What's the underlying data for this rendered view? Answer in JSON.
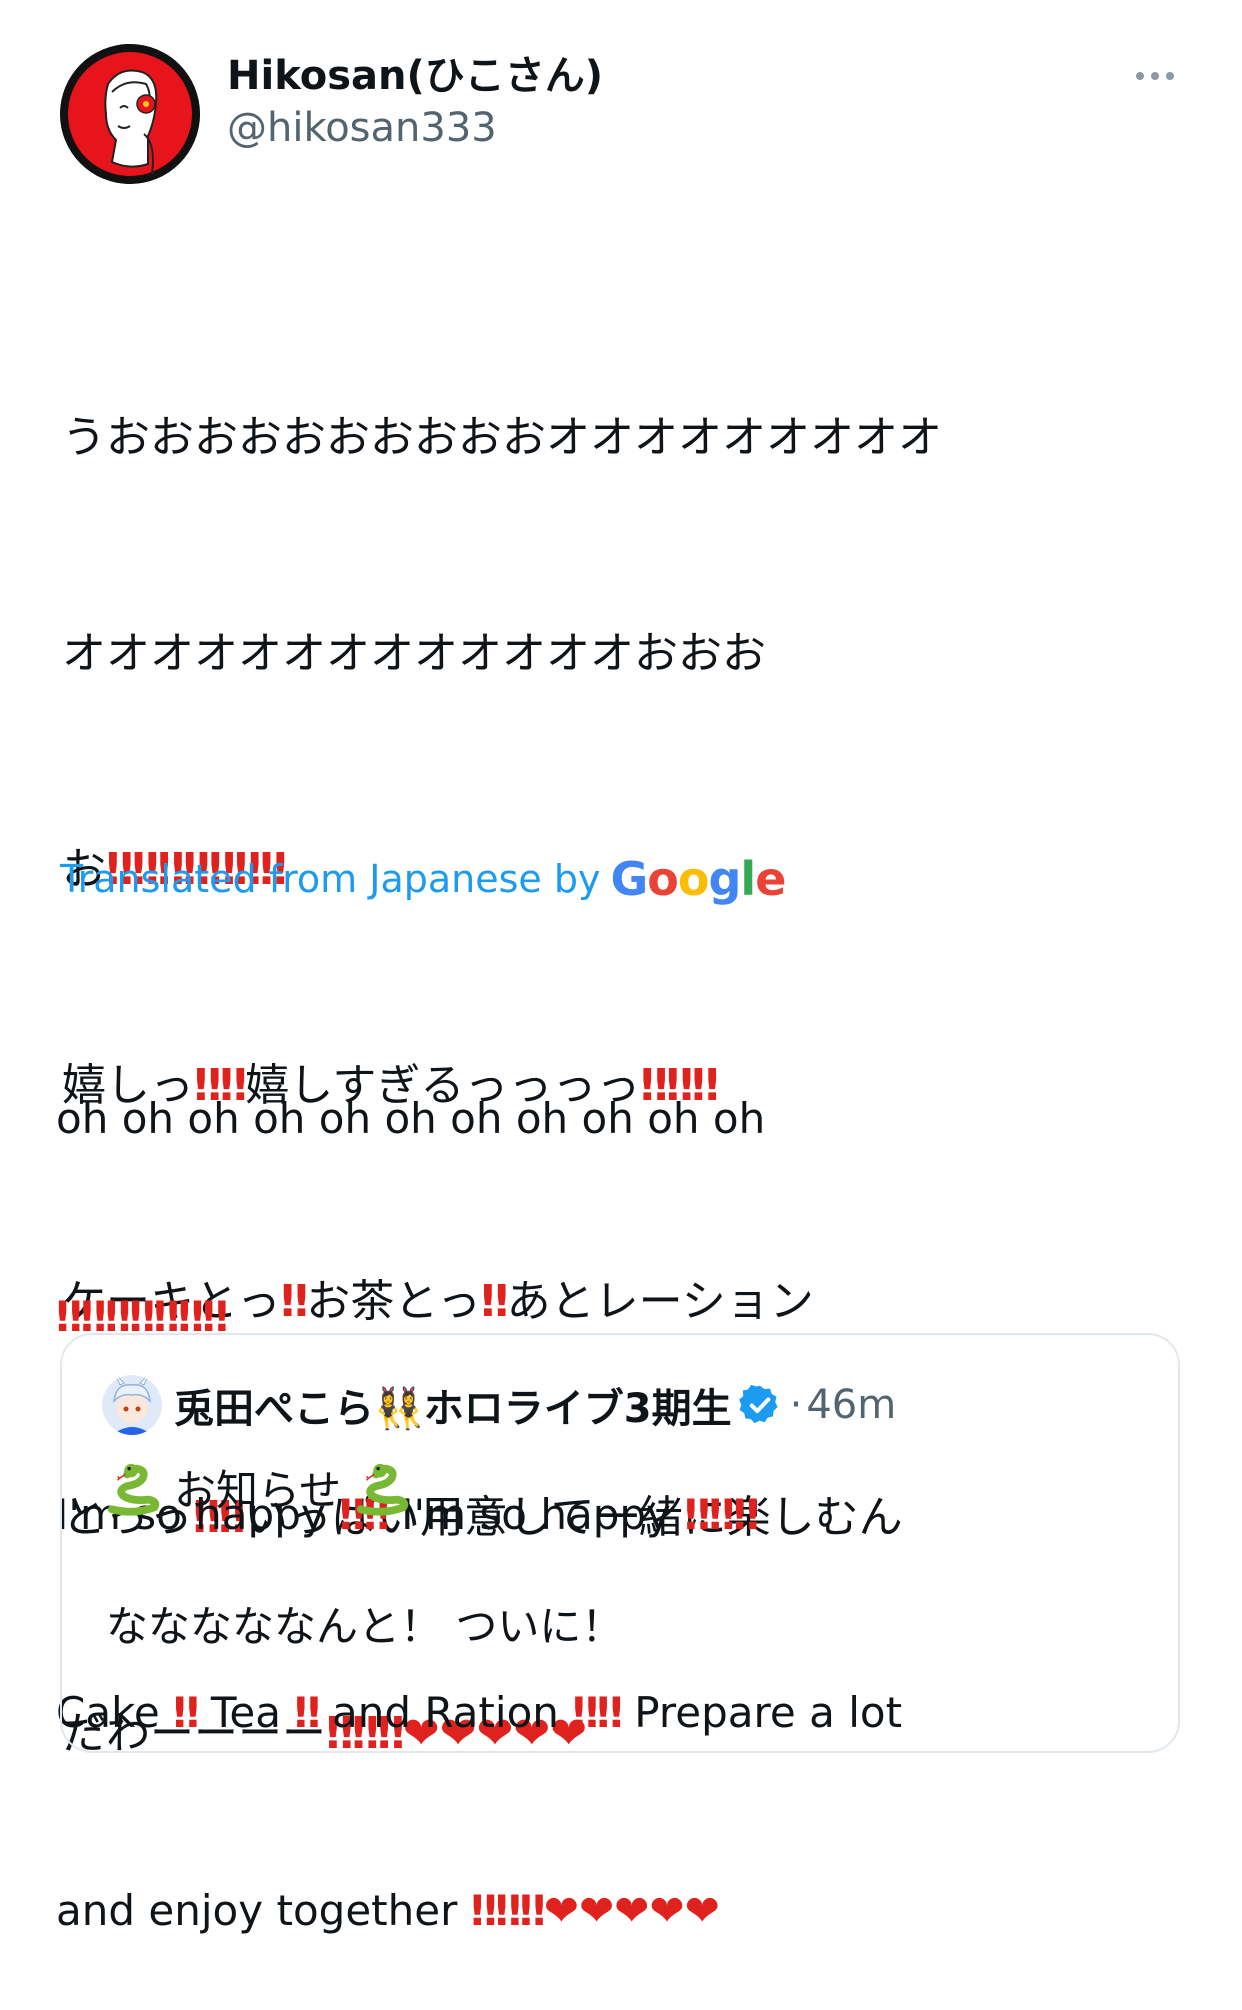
{
  "author": {
    "display_name": "Hikosan(ひこさん)",
    "handle": "@hikosan333",
    "avatar_icon": "portrait-avatar"
  },
  "more_icon": "more-horizontal-icon",
  "tweet": {
    "lines": [
      "うおおおおおおおおおおオオオオオオオオオ",
      "オオオオオオオオオオオオオおおお",
      "お‼️‼️‼️‼️‼️‼️‼️",
      "嬉しっ‼️‼️嬉しすぎるっっっっ‼️‼️‼️",
      "ケーキとっ‼️お茶とっ‼️あとレーション",
      "とっっ‼️‼️いっぱい用意して一緒に楽しむん",
      "だわーーーー‼️‼️‼️❤️❤️❤️❤️❤️"
    ]
  },
  "translation": {
    "label": "Translated from Japanese by",
    "provider": "Google",
    "lines": [
      "oh oh oh oh oh oh oh oh oh oh oh",
      "‼️‼️‼️‼️‼️‼️‼️",
      "I'm so happy ‼️‼️ I'm so happy ‼️‼️‼️",
      "Cake ‼️ Tea ‼️ and Ration ‼️‼️ Prepare a lot",
      "and enjoy together ‼️‼️‼️❤️❤️❤️❤️❤️"
    ]
  },
  "quoted_tweet": {
    "author_name": "兎田ぺこら👯‍♀️ホロライブ3期生",
    "separator": "·",
    "time": "46m",
    "title": "お知らせ",
    "title_icon": "snake-icon",
    "body": "なななななんと！ ついに！",
    "verified_icon": "verified-badge-icon"
  },
  "colors": {
    "link": "#1d9bf0",
    "secondary_text": "#536471",
    "primary_text": "#0f1419",
    "accent_red": "#e0221e",
    "border": "#e1e8ed"
  }
}
